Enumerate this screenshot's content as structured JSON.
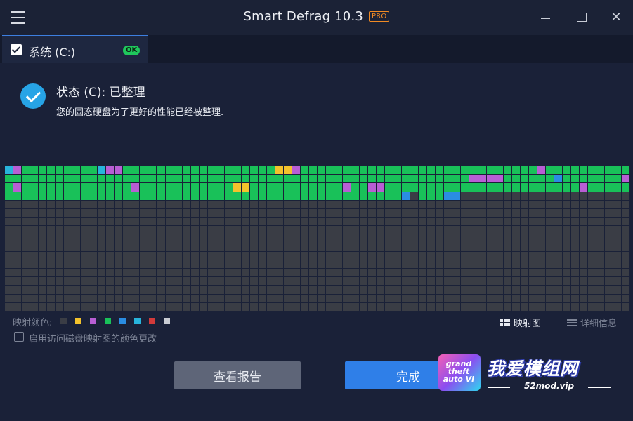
{
  "window": {
    "title": "Smart Defrag 10.3",
    "badge": "PRO",
    "close_glyph": "✕"
  },
  "tab": {
    "label": "系统 (C:)",
    "status_badge": "OK",
    "checked": true
  },
  "status": {
    "title": "状态 (C): 已整理",
    "description": "您的固态硬盘为了更好的性能已经被整理."
  },
  "disk_map": {
    "columns": 74,
    "rows": 17,
    "used_rows": 4,
    "last_row_used_cells": 54,
    "colors": {
      "free": "#3a3d45",
      "used": "#19c159",
      "fragmented": "#b85ed4",
      "directory": "#f3c22c",
      "system": "#2a8de3",
      "mft": "#28b4dc"
    },
    "special_cells": [
      {
        "row": 0,
        "col": 0,
        "type": "mft"
      },
      {
        "row": 0,
        "col": 1,
        "type": "fragmented"
      },
      {
        "row": 0,
        "col": 11,
        "type": "mft"
      },
      {
        "row": 0,
        "col": 12,
        "type": "fragmented"
      },
      {
        "row": 0,
        "col": 13,
        "type": "fragmented"
      },
      {
        "row": 0,
        "col": 32,
        "type": "directory"
      },
      {
        "row": 0,
        "col": 33,
        "type": "directory"
      },
      {
        "row": 0,
        "col": 34,
        "type": "fragmented"
      },
      {
        "row": 0,
        "col": 63,
        "type": "fragmented"
      },
      {
        "row": 1,
        "col": 55,
        "type": "fragmented"
      },
      {
        "row": 1,
        "col": 56,
        "type": "fragmented"
      },
      {
        "row": 1,
        "col": 57,
        "type": "fragmented"
      },
      {
        "row": 1,
        "col": 58,
        "type": "fragmented"
      },
      {
        "row": 1,
        "col": 65,
        "type": "system"
      },
      {
        "row": 1,
        "col": 73,
        "type": "fragmented"
      },
      {
        "row": 2,
        "col": 1,
        "type": "fragmented"
      },
      {
        "row": 2,
        "col": 15,
        "type": "fragmented"
      },
      {
        "row": 2,
        "col": 27,
        "type": "directory"
      },
      {
        "row": 2,
        "col": 28,
        "type": "directory"
      },
      {
        "row": 2,
        "col": 40,
        "type": "fragmented"
      },
      {
        "row": 2,
        "col": 43,
        "type": "fragmented"
      },
      {
        "row": 2,
        "col": 44,
        "type": "fragmented"
      },
      {
        "row": 2,
        "col": 68,
        "type": "fragmented"
      },
      {
        "row": 3,
        "col": 47,
        "type": "system"
      },
      {
        "row": 3,
        "col": 48,
        "type": "free"
      },
      {
        "row": 3,
        "col": 52,
        "type": "system"
      },
      {
        "row": 3,
        "col": 53,
        "type": "system"
      }
    ]
  },
  "legend": {
    "label": "映射颜色:",
    "swatches": [
      "#3a3d45",
      "#f3c22c",
      "#b85ed4",
      "#19c159",
      "#2a8de3",
      "#28b4dc",
      "#d23a3a",
      "#c9ccd3"
    ]
  },
  "view": {
    "map_label": "映射图",
    "detail_label": "详细信息"
  },
  "options": {
    "color_change_label": "启用访问磁盘映射图的颜色更改",
    "color_change_checked": false
  },
  "buttons": {
    "report_label": "查看报告",
    "finish_label": "完成"
  },
  "watermark": {
    "logo_text": "grand theft auto VI",
    "site_name": "我爱模组网",
    "url": "52mod.vip"
  }
}
